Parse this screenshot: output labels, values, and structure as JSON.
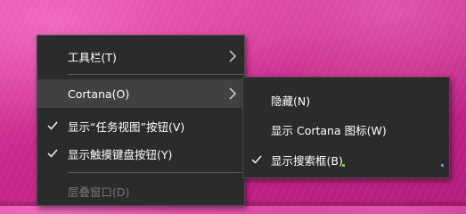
{
  "main_menu": {
    "items": [
      {
        "label": "工具栏(T)",
        "has_submenu": true
      },
      {
        "label": "Cortana(O)",
        "has_submenu": true
      },
      {
        "label": "显示“任务视图”按钮(V)",
        "checked": true
      },
      {
        "label": "显示触摸键盘按钮(Y)",
        "checked": true
      },
      {
        "label": "层叠窗口(D)",
        "disabled": true
      }
    ]
  },
  "sub_menu": {
    "items": [
      {
        "label": "隐藏(N)"
      },
      {
        "label": "显示 Cortana 图标(W)"
      },
      {
        "label": "显示搜索框(B)",
        "checked": true
      }
    ]
  },
  "colors": {
    "menu_background": "#2b2b2b",
    "menu_hover": "#414141",
    "text": "#ffffff",
    "disabled_text": "#777777",
    "wallpaper": "#c9278a"
  },
  "icons": {
    "submenu_arrow": "chevron-right-icon",
    "checkmark": "checkmark-icon"
  }
}
